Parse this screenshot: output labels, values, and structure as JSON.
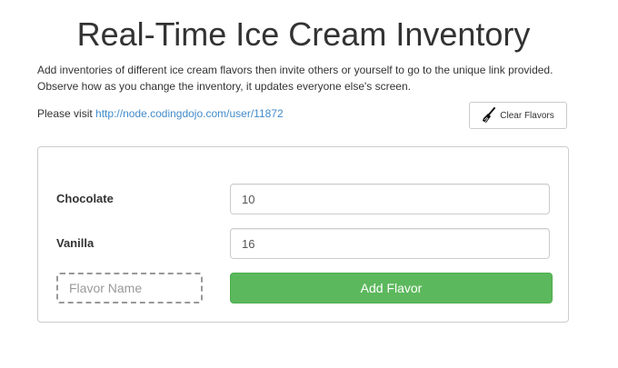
{
  "header": {
    "title": "Real-Time Ice Cream Inventory",
    "intro_line1": "Add inventories of different ice cream flavors then invite others or yourself to go to the unique link provided.",
    "intro_line2": "Observe how as you change the inventory, it updates everyone else's screen.",
    "visit_prefix": "Please visit",
    "visit_link": "http://node.codingdojo.com/user/11872"
  },
  "toolbar": {
    "clear_label": "Clear Flavors",
    "clear_icon": "broom-icon"
  },
  "flavors": [
    {
      "name": "Chocolate",
      "quantity": "10"
    },
    {
      "name": "Vanilla",
      "quantity": "16"
    }
  ],
  "new_flavor": {
    "placeholder": "Flavor Name",
    "add_label": "Add Flavor"
  },
  "colors": {
    "link": "#428bca",
    "add_button": "#5cb85c",
    "text": "#333333"
  }
}
